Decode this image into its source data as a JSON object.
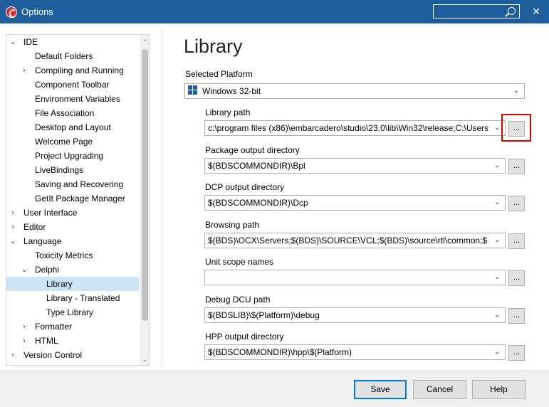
{
  "window": {
    "title": "Options",
    "close_glyph": "✕"
  },
  "tree": {
    "items": [
      {
        "label": "IDE",
        "arrow": "⌄",
        "level": 0
      },
      {
        "label": "Default Folders",
        "arrow": "",
        "level": 2
      },
      {
        "label": "Compiling and Running",
        "arrow": "›",
        "level": 1
      },
      {
        "label": "Component Toolbar",
        "arrow": "",
        "level": 2
      },
      {
        "label": "Environment Variables",
        "arrow": "",
        "level": 2
      },
      {
        "label": "File Association",
        "arrow": "",
        "level": 2
      },
      {
        "label": "Desktop and Layout",
        "arrow": "",
        "level": 2
      },
      {
        "label": "Welcome Page",
        "arrow": "",
        "level": 2
      },
      {
        "label": "Project Upgrading",
        "arrow": "",
        "level": 2
      },
      {
        "label": "LiveBindings",
        "arrow": "",
        "level": 2
      },
      {
        "label": "Saving and Recovering",
        "arrow": "",
        "level": 2
      },
      {
        "label": "GetIt Package Manager",
        "arrow": "",
        "level": 2
      },
      {
        "label": "User Interface",
        "arrow": "›",
        "level": 0
      },
      {
        "label": "Editor",
        "arrow": "›",
        "level": 0
      },
      {
        "label": "Language",
        "arrow": "⌄",
        "level": 0
      },
      {
        "label": "Toxicity Metrics",
        "arrow": "",
        "level": 2
      },
      {
        "label": "Delphi",
        "arrow": "⌄",
        "level": 1
      },
      {
        "label": "Library",
        "arrow": "",
        "level": 3,
        "selected": true
      },
      {
        "label": "Library - Translated",
        "arrow": "",
        "level": 3
      },
      {
        "label": "Type Library",
        "arrow": "",
        "level": 3
      },
      {
        "label": "Formatter",
        "arrow": "›",
        "level": 1
      },
      {
        "label": "HTML",
        "arrow": "›",
        "level": 1
      },
      {
        "label": "Version Control",
        "arrow": "›",
        "level": 0
      }
    ],
    "scroll_up": "⌃",
    "scroll_down": "⌄"
  },
  "main": {
    "title": "Library",
    "platform_label": "Selected Platform",
    "platform_value": "Windows 32-bit",
    "fields": [
      {
        "label": "Library path",
        "value": "c:\\program files (x86)\\embarcadero\\studio\\23.0\\lib\\Win32\\release;C:\\Users\\"
      },
      {
        "label": "Package output directory",
        "value": "$(BDSCOMMONDIR)\\Bpl"
      },
      {
        "label": "DCP output directory",
        "value": "$(BDSCOMMONDIR)\\Dcp"
      },
      {
        "label": "Browsing path",
        "value": "$(BDS)\\OCX\\Servers;$(BDS)\\SOURCE\\VCL;$(BDS)\\source\\rtl\\common;$(BDS"
      },
      {
        "label": "Unit scope names",
        "value": ""
      },
      {
        "label": "Debug DCU path",
        "value": "$(BDSLIB)\\$(Platform)\\debug"
      },
      {
        "label": "HPP output directory",
        "value": "$(BDSCOMMONDIR)\\hpp\\$(Platform)"
      }
    ],
    "ellipsis": "...",
    "chevron": "⌄"
  },
  "footer": {
    "save": "Save",
    "cancel": "Cancel",
    "help": "Help"
  },
  "colors": {
    "titlebar": "#1f5e9c",
    "selection": "#cce4f7",
    "highlight": "#e00000"
  }
}
